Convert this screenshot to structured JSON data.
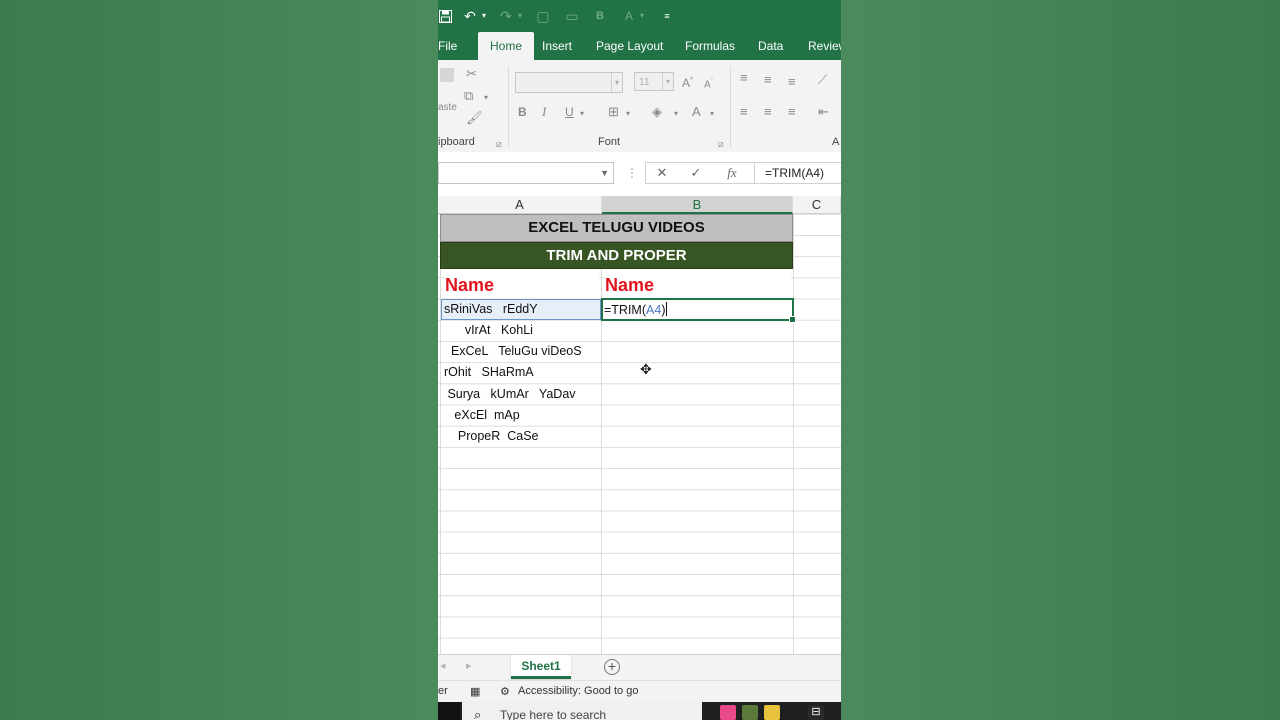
{
  "qat": {
    "save_icon": "save-icon",
    "undo_icon": "undo-icon",
    "redo_icon": "redo-icon"
  },
  "tabs": [
    {
      "label": "File"
    },
    {
      "label": "Home"
    },
    {
      "label": "Insert"
    },
    {
      "label": "Page Layout"
    },
    {
      "label": "Formulas"
    },
    {
      "label": "Data"
    },
    {
      "label": "Review"
    }
  ],
  "ribbon": {
    "clipboard_label": "ipboard",
    "paste_label": "aste",
    "font_label": "Font",
    "font_size": "11",
    "bold": "B",
    "italic": "I",
    "underline": "U",
    "alignment_label": "A"
  },
  "formula_bar": {
    "name_box": "",
    "cancel": "✕",
    "enter": "✓",
    "fx": "fx",
    "formula": "=TRIM(A4)"
  },
  "columns": [
    {
      "label": "A"
    },
    {
      "label": "B"
    },
    {
      "label": "C"
    }
  ],
  "sheet": {
    "title": "EXCEL TELUGU VIDEOS",
    "subtitle": "TRIM AND PROPER",
    "header_a": "Name",
    "header_b": "Name",
    "rows": [
      {
        "a": "sRiniVas   rEddY"
      },
      {
        "a": "      vIrAt   KohLi"
      },
      {
        "a": "  ExCeL   TeluGu viDeoS"
      },
      {
        "a": "rOhit   SHaRmA"
      },
      {
        "a": " Surya   kUmAr   YaDav"
      },
      {
        "a": "   eXcEl  mAp"
      },
      {
        "a": "    PropeR  CaSe"
      }
    ],
    "edit_prefix": "=TRIM(",
    "edit_ref": "A4",
    "edit_suffix": ")"
  },
  "sheet_tabs": {
    "active": "Sheet1",
    "add": "+"
  },
  "status": {
    "mode": "er",
    "accessibility": "Accessibility: Good to go"
  },
  "taskbar": {
    "search_placeholder": "Type here to search"
  },
  "colors": {
    "excel_green": "#217346",
    "title_bg": "#bfbfbf",
    "subtitle_bg": "#375623",
    "header_red": "#e0161e"
  }
}
